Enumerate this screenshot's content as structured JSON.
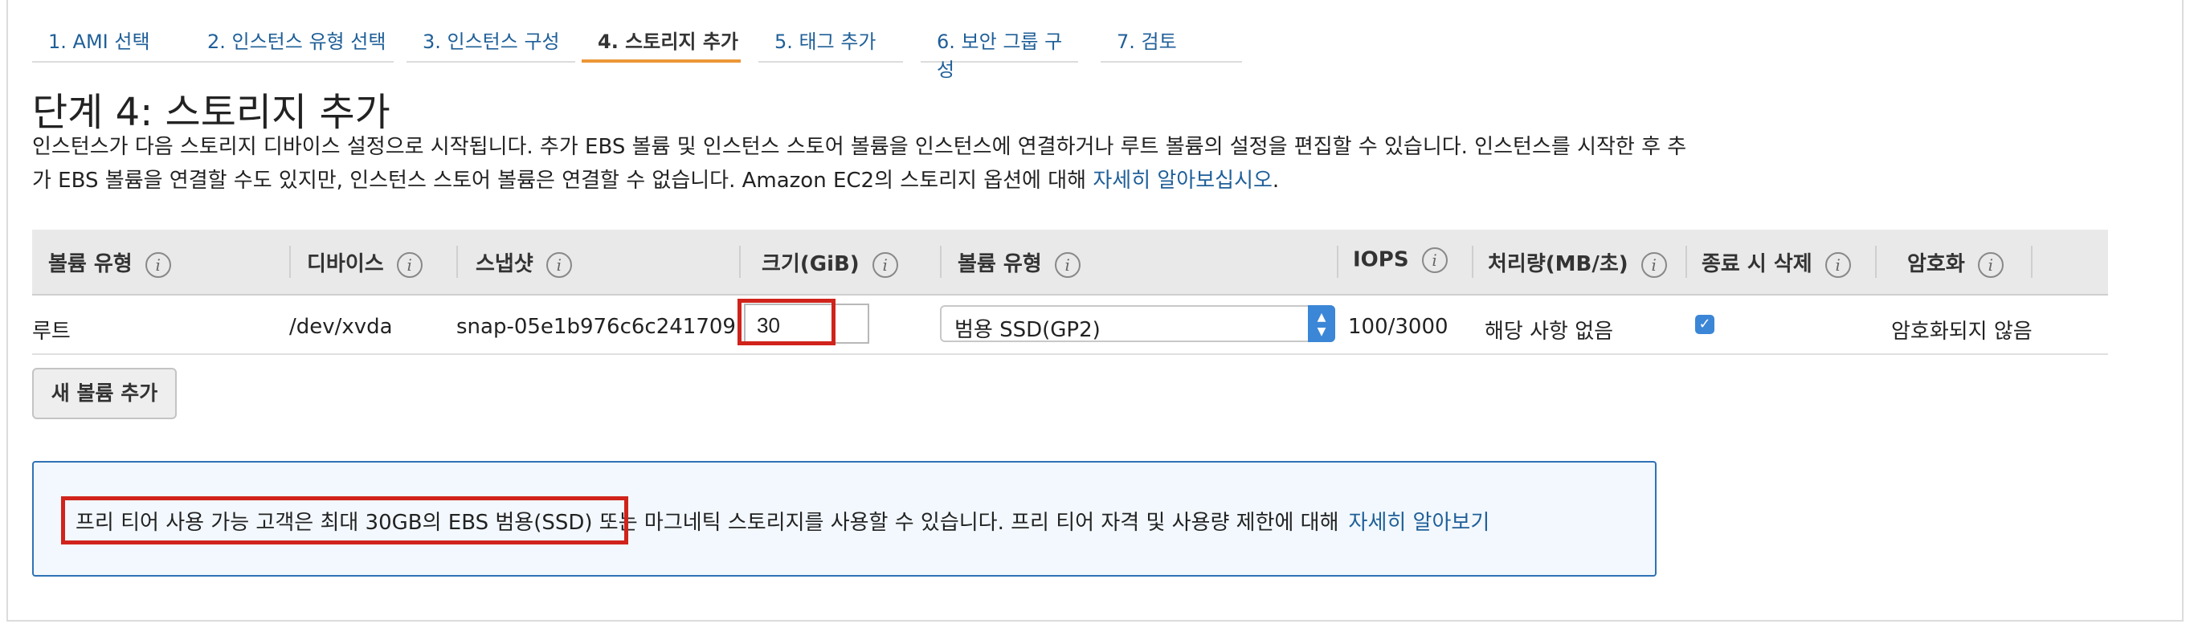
{
  "tabs": [
    {
      "label": "1. AMI 선택"
    },
    {
      "label": "2. 인스턴스 유형 선택"
    },
    {
      "label": "3. 인스턴스 구성"
    },
    {
      "label": "4. 스토리지 추가"
    },
    {
      "label": "5. 태그 추가"
    },
    {
      "label": "6. 보안 그룹 구성"
    },
    {
      "label": "7. 검토"
    }
  ],
  "active_tab": 3,
  "page": {
    "title": "단계 4: 스토리지 추가",
    "description": "인스턴스가 다음 스토리지 디바이스 설정으로 시작됩니다. 추가 EBS 볼륨 및 인스턴스 스토어 볼륨을 인스턴스에 연결하거나 루트 볼륨의 설정을 편집할 수 있습니다. 인스턴스를 시작한 후 추가 EBS 볼륨을 연결할 수도 있지만, 인스턴스 스토어 볼륨은 연결할 수 없습니다. Amazon EC2의 스토리지 옵션에 대해 ",
    "description_link": "자세히 알아보십시오",
    "description_end": "."
  },
  "table": {
    "headers": [
      "볼륨 유형",
      "디바이스",
      "스냅샷",
      "크기(GiB)",
      "볼륨 유형",
      "IOPS",
      "처리량(MB/초)",
      "종료 시 삭제",
      "암호화"
    ],
    "info_icon": "i",
    "row": {
      "volume_type": "루트",
      "device": "/dev/xvda",
      "snapshot": "snap-05e1b976c6c241709",
      "size": "30",
      "volume_kind": "범용 SSD(GP2)",
      "iops": "100/3000",
      "throughput": "해당 사항 없음",
      "delete_on_termination": true,
      "encryption": "암호화되지 않음"
    }
  },
  "add_volume_button": "새 볼륨 추가",
  "notice": {
    "text": "프리 티어 사용 가능 고객은 최대 30GB의 EBS 범용(SSD) 또는 마그네틱 스토리지를 사용할 수 있습니다. 프리 티어 자격 및 사용량 제한에 대해",
    "link": "자세히 알아보기"
  },
  "colors": {
    "link": "#1f5f98",
    "active_tab_underline": "#ec9737",
    "highlight_box": "#d0231b",
    "notice_border": "#2f72b5",
    "notice_bg": "#f2f8fd",
    "header_bg": "#e9e9e9",
    "control_blue": "#3b86d6"
  },
  "icons": {
    "info": "info-icon",
    "select_spinner": "chevron-updown-icon",
    "checkbox": "checkmark-icon"
  }
}
